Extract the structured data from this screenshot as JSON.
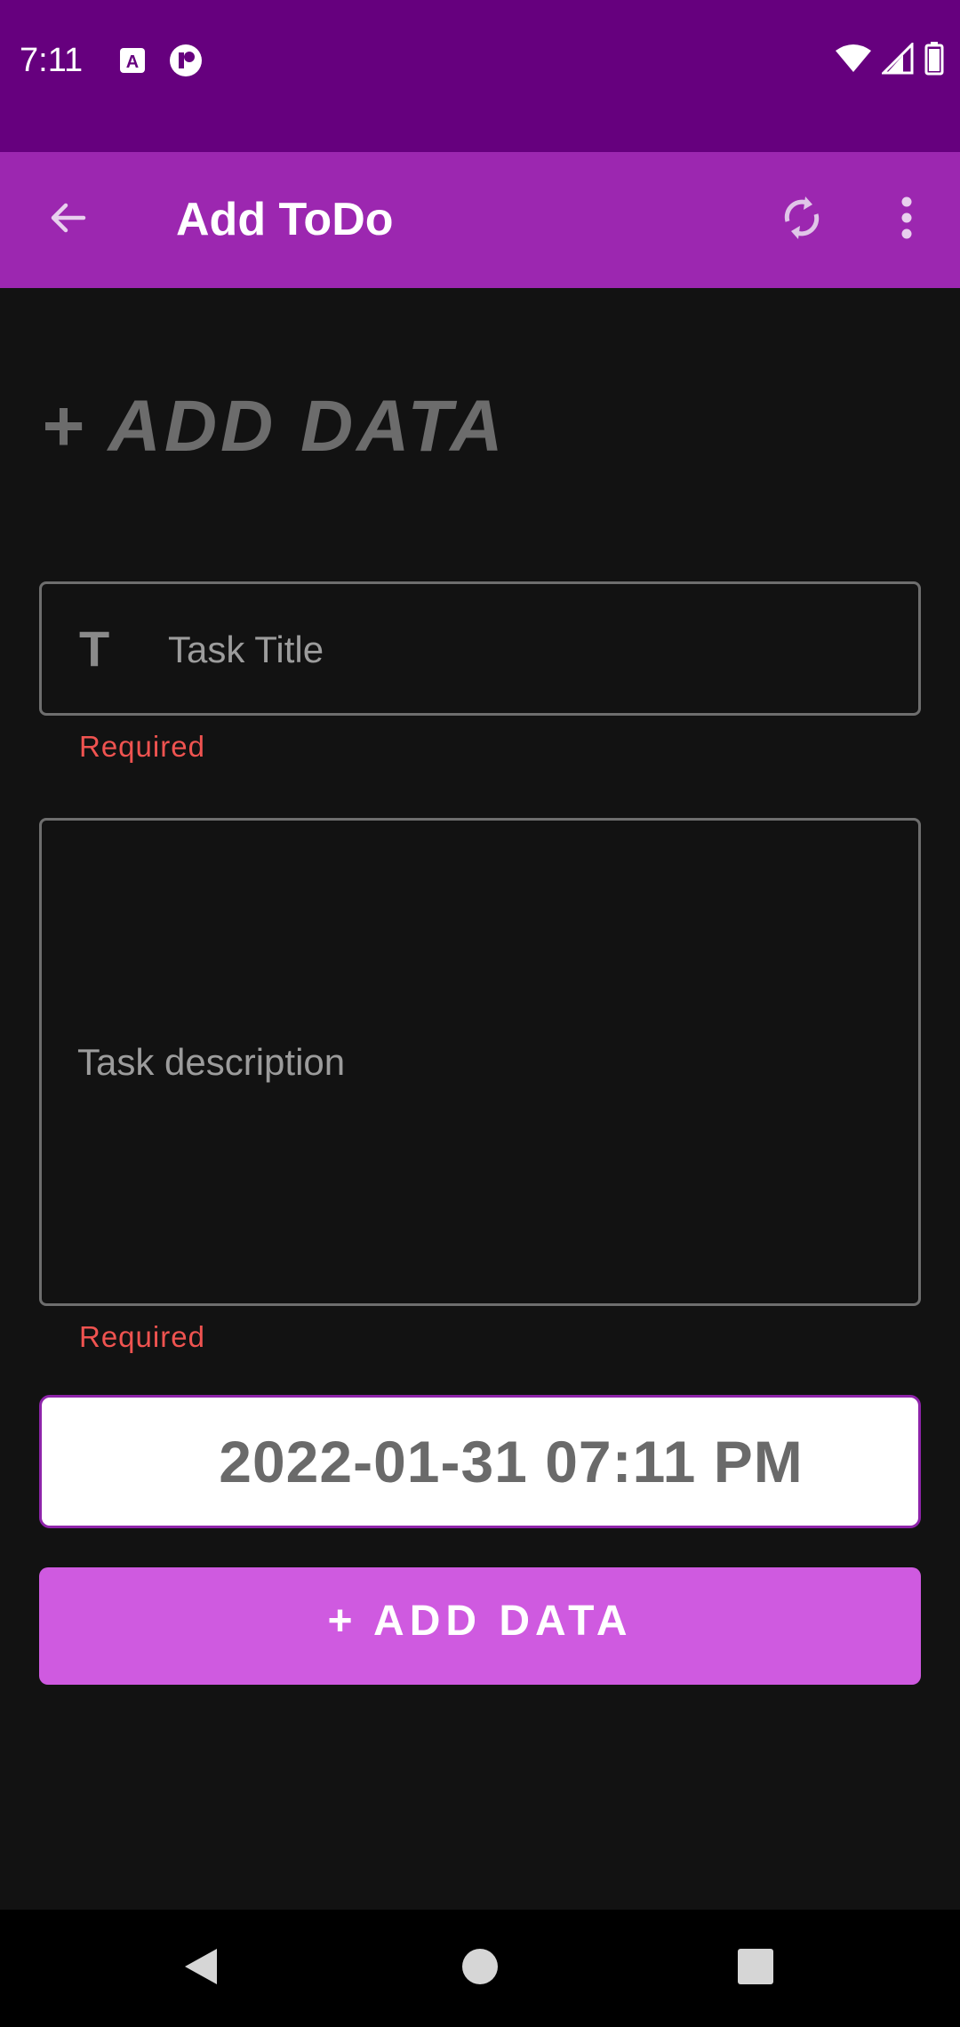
{
  "status_bar": {
    "time": "7:11",
    "icons": [
      "keyboard-a-icon",
      "app-notification-icon",
      "wifi-icon",
      "signal-icon",
      "battery-icon"
    ]
  },
  "app_bar": {
    "title": "Add ToDo",
    "icons": [
      "back-arrow-icon",
      "sync-icon",
      "more-vert-icon"
    ]
  },
  "form": {
    "heading": "+ ADD DATA",
    "title_field": {
      "placeholder": "Task Title",
      "value": "",
      "icon": "text-t-icon",
      "error": "Required"
    },
    "description_field": {
      "placeholder": "Task description",
      "value": "",
      "error": "Required"
    },
    "date_button": "2022-01-31 07:11 PM",
    "submit_button": "+ ADD DATA"
  },
  "nav_bar": {
    "icons": [
      "back-triangle-icon",
      "home-circle-icon",
      "recents-square-icon"
    ]
  },
  "colors": {
    "status_bar": "#66007e",
    "app_bar": "#9c27b0",
    "background": "#121212",
    "error": "#ef5350",
    "accent_button": "#cf5ae0"
  }
}
